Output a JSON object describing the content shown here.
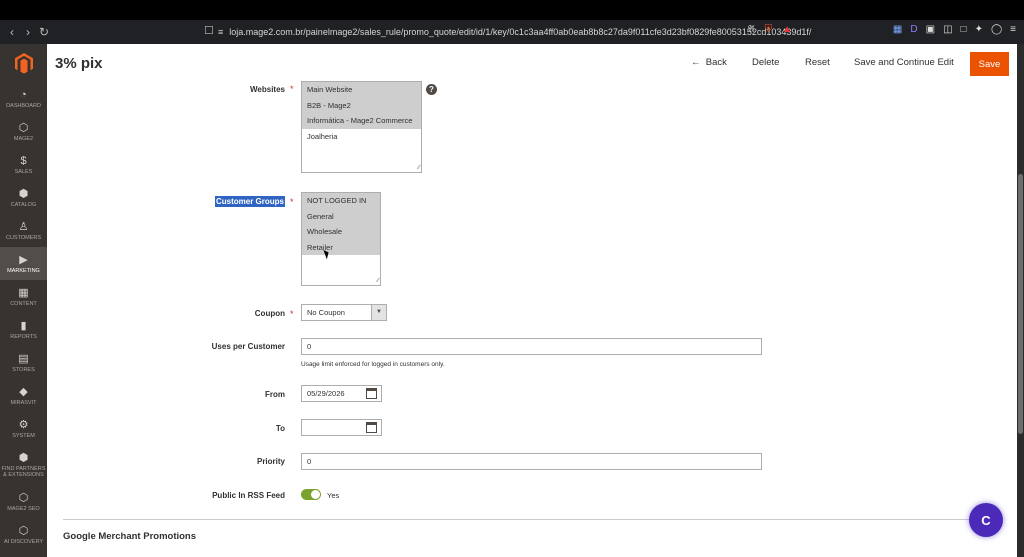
{
  "browser": {
    "url": "loja.mage2.com.br/painelmage2/sales_rule/promo_quote/edit/id/1/key/0c1c3aa4ff0ab0eab8b8c27da9f011cfe3d23bf0829fe80053152cd103439d1f/"
  },
  "sidebar": {
    "items": [
      {
        "label": "Dashboard",
        "icon": "dashboard-icon"
      },
      {
        "label": "Mage2",
        "icon": "hexagon-icon"
      },
      {
        "label": "Sales",
        "icon": "dollar-icon"
      },
      {
        "label": "Catalog",
        "icon": "cube-icon"
      },
      {
        "label": "Customers",
        "icon": "person-icon"
      },
      {
        "label": "Marketing",
        "icon": "megaphone-icon",
        "active": true
      },
      {
        "label": "Content",
        "icon": "content-icon"
      },
      {
        "label": "Reports",
        "icon": "bar-chart-icon"
      },
      {
        "label": "Stores",
        "icon": "store-icon"
      },
      {
        "label": "Mirasvit",
        "icon": "diamond-icon"
      },
      {
        "label": "System",
        "icon": "gear-icon"
      },
      {
        "label": "Find Partners & Extensions",
        "icon": "box-icon"
      },
      {
        "label": "Mage2 SEO",
        "icon": "hexagon-icon"
      },
      {
        "label": "AI Discovery",
        "icon": "hexagon-icon"
      }
    ]
  },
  "header": {
    "title": "3% pix",
    "back_label": "Back",
    "delete_label": "Delete",
    "reset_label": "Reset",
    "save_continue_label": "Save and Continue Edit",
    "save_label": "Save"
  },
  "form": {
    "websites": {
      "label": "Websites",
      "options": [
        "Main Website",
        "B2B - Mage2",
        "Informática - Mage2 Commerce",
        "Joalheria"
      ],
      "selected": [
        true,
        true,
        true,
        false
      ]
    },
    "customer_groups": {
      "label": "Customer Groups",
      "options": [
        "NOT LOGGED IN",
        "General",
        "Wholesale",
        "Retailer"
      ],
      "selected": [
        true,
        true,
        true,
        true
      ]
    },
    "coupon": {
      "label": "Coupon",
      "value": "No Coupon"
    },
    "uses_per_customer": {
      "label": "Uses per Customer",
      "value": "0",
      "note": "Usage limit enforced for logged in customers only."
    },
    "from": {
      "label": "From",
      "value": "05/29/2026"
    },
    "to": {
      "label": "To",
      "value": ""
    },
    "priority": {
      "label": "Priority",
      "value": "0"
    },
    "rss": {
      "label": "Public In RSS Feed",
      "value_label": "Yes",
      "enabled": true
    }
  },
  "sections": {
    "google_merchant": "Google Merchant Promotions"
  },
  "chat": {
    "label": "C"
  }
}
